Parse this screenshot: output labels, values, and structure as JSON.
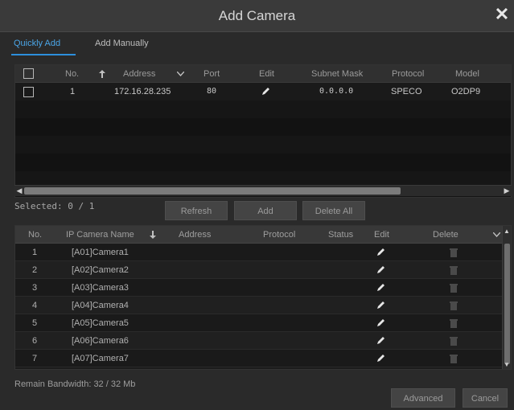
{
  "dialog": {
    "title": "Add Camera",
    "close_glyph": "✕"
  },
  "tabs": {
    "quick": "Quickly Add",
    "manual": "Add Manually"
  },
  "search_table": {
    "headers": {
      "no": "No.",
      "address": "Address",
      "port": "Port",
      "edit": "Edit",
      "subnet": "Subnet Mask",
      "protocol": "Protocol",
      "model": "Model"
    },
    "rows": [
      {
        "no": "1",
        "address": "172.16.28.235",
        "port": "80",
        "subnet": "0.0.0.0",
        "protocol": "SPECO",
        "model": "O2DP9"
      }
    ]
  },
  "selected": "Selected: 0 / 1",
  "buttons": {
    "refresh": "Refresh",
    "add": "Add",
    "delete_all": "Delete All",
    "advanced": "Advanced",
    "cancel": "Cancel"
  },
  "camera_table": {
    "headers": {
      "no": "No.",
      "name": "IP Camera Name",
      "address": "Address",
      "protocol": "Protocol",
      "status": "Status",
      "edit": "Edit",
      "delete": "Delete"
    },
    "rows": [
      {
        "no": "1",
        "name": "[A01]Camera1"
      },
      {
        "no": "2",
        "name": "[A02]Camera2"
      },
      {
        "no": "3",
        "name": "[A03]Camera3"
      },
      {
        "no": "4",
        "name": "[A04]Camera4"
      },
      {
        "no": "5",
        "name": "[A05]Camera5"
      },
      {
        "no": "6",
        "name": "[A06]Camera6"
      },
      {
        "no": "7",
        "name": "[A07]Camera7"
      }
    ]
  },
  "bandwidth": "Remain Bandwidth: 32 / 32 Mb",
  "icons": {
    "sort_asc": "arrow-up-icon",
    "sort_desc": "arrow-down-icon",
    "edit": "pencil-icon",
    "delete": "trash-icon",
    "dropdown": "chevron-down-icon"
  },
  "colors": {
    "accent": "#2d8fdc",
    "tab_active": "#4ba6e8",
    "background": "#2a2a2a"
  }
}
